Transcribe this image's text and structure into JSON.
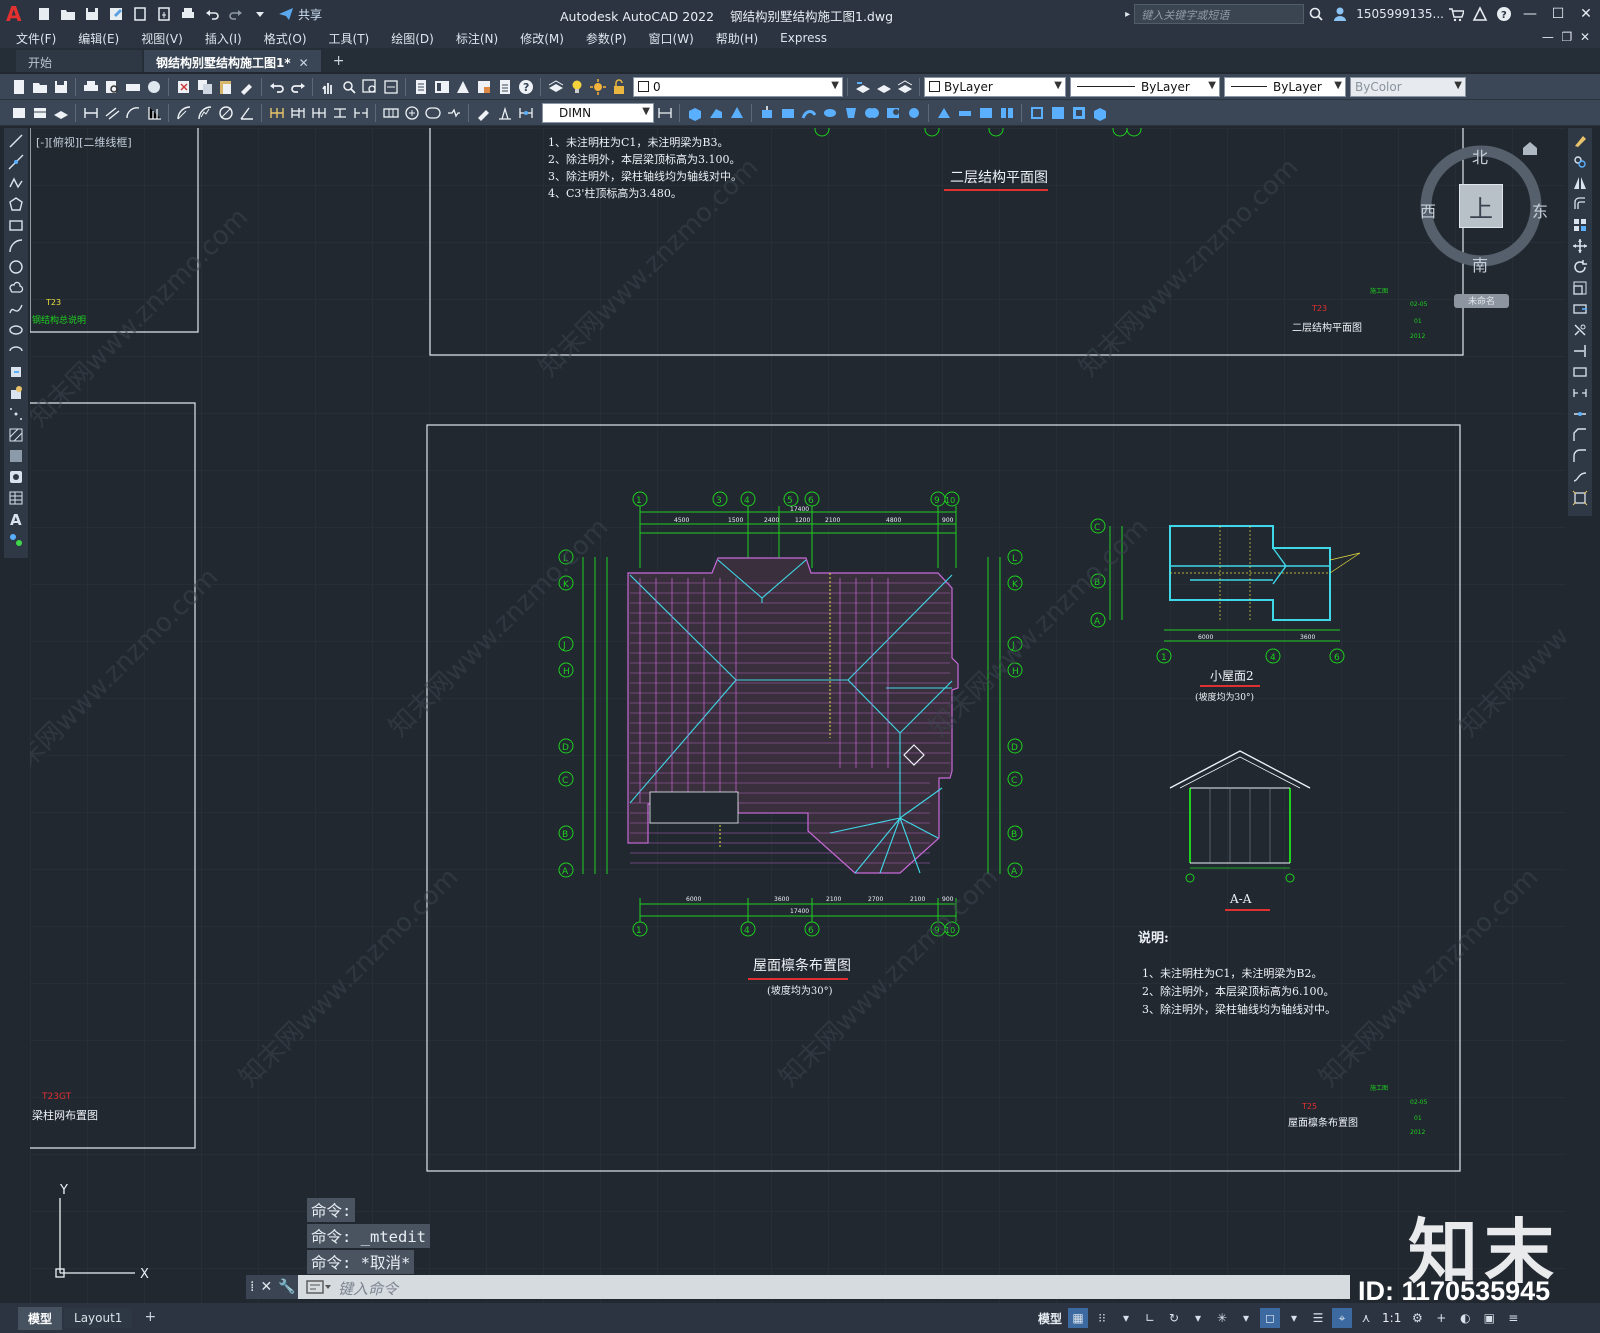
{
  "titlebar": {
    "app_title": "Autodesk AutoCAD 2022",
    "file_title": "钢结构别墅结构施工图1.dwg",
    "share_label": "共享",
    "search_placeholder": "键入关键字或短语",
    "user": "1505999135...",
    "app_logo": "A"
  },
  "menu": [
    "文件(F)",
    "编辑(E)",
    "视图(V)",
    "插入(I)",
    "格式(O)",
    "工具(T)",
    "绘图(D)",
    "标注(N)",
    "修改(M)",
    "参数(P)",
    "窗口(W)",
    "帮助(H)",
    "Express"
  ],
  "tabs": {
    "start": "开始",
    "active": "钢结构别墅结构施工图1*",
    "close": "✕",
    "add": "+"
  },
  "toolbar": {
    "layer_value": "0",
    "color_value": "ByLayer",
    "linetype_value": "ByLayer",
    "lineweight_value": "ByLayer",
    "plotstyle_value": "ByColor",
    "dimstyle_value": "DIMN"
  },
  "viewport_label": "[-][俯视][二维线框]",
  "viewcube": {
    "north": "北",
    "south": "南",
    "east": "东",
    "west": "西",
    "face": "上",
    "wcs": "未命名"
  },
  "drawing": {
    "top_notes": [
      "1、未注明柱为C1，未注明梁为B3。",
      "2、除注明外，本层梁顶标高为3.100。",
      "3、除注明外，梁柱轴线均为轴线对中。",
      "4、C3'柱顶标高为3.480。"
    ],
    "second_floor_title": "二层结构平面图",
    "left_sheet_top_no": "T23",
    "left_sheet_top_title": "钢结构总说明",
    "left_sheet_bottom_no": "T23GT",
    "left_sheet_bottom_title": "梁柱网布置图",
    "titleblock_top_no": "T23",
    "titleblock_top_title": "二层结构平面图",
    "titleblock_bottom_no": "T25",
    "titleblock_bottom_title": "屋面檩条布置图",
    "roof_title": "屋面檩条布置图",
    "roof_subtitle": "(坡度均为30°)",
    "small_roof_title": "小屋面2",
    "small_roof_subtitle": "(坡度均为30°)",
    "section_title": "A-A",
    "notes_heading": "说明:",
    "bottom_notes": [
      "1、未注明柱为C1，未注明梁为B2。",
      "2、除注明外，本层梁顶标高为6.100。",
      "3、除注明外，梁柱轴线均为轴线对中。"
    ],
    "dims_top": [
      "4500",
      "1500",
      "2400",
      "1200",
      "2100",
      "4800",
      "900"
    ],
    "dims_total": "17400",
    "dims_bottom": [
      "6000",
      "3600",
      "2100",
      "2700",
      "2100",
      "900"
    ],
    "axis_top": [
      "1",
      "3",
      "4",
      "5",
      "6",
      "9",
      "10"
    ],
    "axis_side": [
      "L",
      "K",
      "J",
      "H",
      "D",
      "C",
      "B",
      "A"
    ],
    "small_axis_bottom": [
      "1",
      "4",
      "6"
    ],
    "small_axis_side": [
      "C",
      "B",
      "A"
    ],
    "small_dims": [
      "6000",
      "3600"
    ]
  },
  "command": {
    "history": [
      "命令:",
      "命令: _mtedit",
      "命令: *取消*"
    ],
    "placeholder": "键入命令"
  },
  "status": {
    "tab_model": "模型",
    "tab_layout": "Layout1",
    "model_label": "模型",
    "scale": "1:1"
  },
  "watermark": {
    "brand": "知末",
    "id": "ID: 1170535945",
    "site": "知末网www.znzmo.com"
  },
  "colors": {
    "background": "#212830",
    "cad_green": "#1fd01f",
    "cad_cyan": "#3fd8e8",
    "cad_magenta": "#c86ad8",
    "cad_red": "#e03030",
    "cad_yellow": "#e8e040"
  }
}
